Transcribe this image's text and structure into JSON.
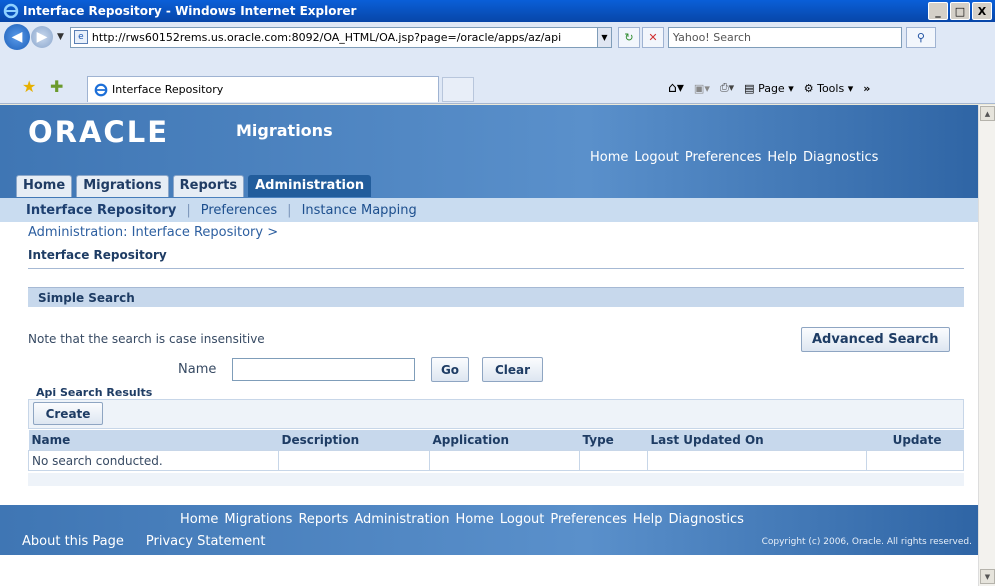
{
  "window": {
    "title": "Interface Repository - Windows Internet Explorer",
    "min": "_",
    "max": "□",
    "close": "X"
  },
  "browser": {
    "address": "http://rws60152rems.us.oracle.com:8092/OA_HTML/OA.jsp?page=/oracle/apps/az/api",
    "search_placeholder": "Yahoo! Search",
    "tab_label": "Interface Repository",
    "commands": [
      "Page",
      "Tools"
    ]
  },
  "app": {
    "logo": "ORACLE",
    "title": "Migrations",
    "global_nav": [
      "Home",
      "Logout",
      "Preferences",
      "Help",
      "Diagnostics"
    ],
    "tabs": [
      "Home",
      "Migrations",
      "Reports",
      "Administration"
    ],
    "subtabs": [
      "Interface Repository",
      "Preferences",
      "Instance Mapping"
    ],
    "breadcrumb": "Administration: Interface Repository  >",
    "page_title": "Interface Repository"
  },
  "search": {
    "header": "Simple Search",
    "note": "Note that the search is case insensitive",
    "advanced_label": "Advanced Search",
    "name_label": "Name",
    "name_value": "",
    "go_label": "Go",
    "clear_label": "Clear"
  },
  "results": {
    "title": "Api Search Results",
    "create_label": "Create",
    "columns": [
      "Name",
      "Description",
      "Application",
      "Type",
      "Last Updated On",
      "Update"
    ],
    "empty_message": "No search conducted."
  },
  "footer": {
    "nav": [
      "Home",
      "Migrations",
      "Reports",
      "Administration",
      "Home",
      "Logout",
      "Preferences",
      "Help",
      "Diagnostics"
    ],
    "about": "About this Page",
    "privacy": "Privacy Statement",
    "copyright": "Copyright (c) 2006, Oracle. All rights reserved."
  }
}
